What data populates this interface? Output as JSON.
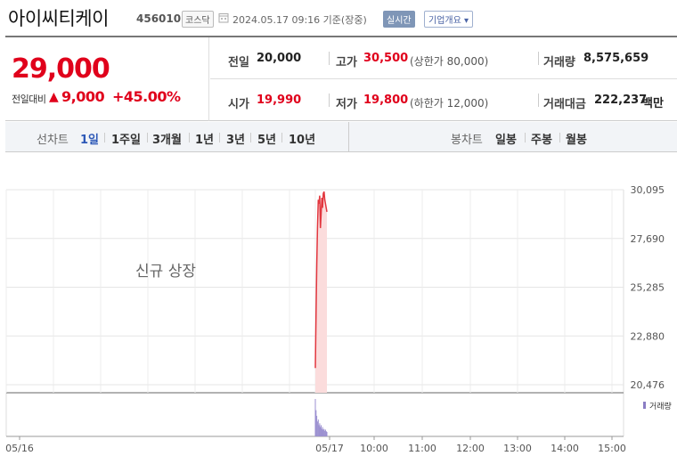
{
  "header": {
    "name": "아이씨티케이",
    "code": "456010",
    "market": "코스닥",
    "datetime": "2024.05.17 09:16 기준(장중)",
    "realtime_label": "실시간",
    "company_button": "기업개요 ▾"
  },
  "price": {
    "current": "29,000",
    "change_label": "전일대비",
    "change_arrow": "▲",
    "change": "9,000",
    "change_pct": "+45.00%"
  },
  "stats": {
    "prev_label": "전일",
    "prev": "20,000",
    "high_label": "고가",
    "high": "30,500",
    "upper_limit": "(상한가 80,000)",
    "volume_label": "거래량",
    "volume": "8,575,659",
    "open_label": "시가",
    "open": "19,990",
    "low_label": "저가",
    "low": "19,800",
    "lower_limit": "(하한가 12,000)",
    "amount_label": "거래대금",
    "amount": "222,237",
    "amount_unit": "백만"
  },
  "tabs": {
    "line_label": "선차트",
    "line_items": [
      "1일",
      "1주일",
      "3개월",
      "1년",
      "3년",
      "5년",
      "10년"
    ],
    "active": "1일",
    "candle_label": "봉차트",
    "candle_items": [
      "일봉",
      "주봉",
      "월봉"
    ]
  },
  "colors": {
    "up": "#e0001b",
    "line": "#e2373f",
    "area": "#fbdcdc",
    "volume": "#9b8fd0",
    "active_tab": "#2d58b7"
  },
  "chart_data": {
    "type": "line",
    "annotation": "신규 상장",
    "y_ticks": [
      "30,095",
      "27,690",
      "25,285",
      "22,880",
      "20,476"
    ],
    "ylim": [
      20476,
      30095
    ],
    "x_ticks": [
      "05/16",
      "05/17",
      "10:00",
      "11:00",
      "12:00",
      "13:00",
      "14:00",
      "15:00"
    ],
    "series": [
      {
        "x": [
          "09:00",
          "09:01",
          "09:02",
          "09:03",
          "09:04",
          "09:05",
          "09:06",
          "09:07",
          "09:08",
          "09:09",
          "09:10",
          "09:11",
          "09:12",
          "09:13",
          "09:14",
          "09:15",
          "09:16"
        ],
        "values": [
          21300,
          24000,
          26400,
          28200,
          29600,
          29400,
          29800,
          28200,
          28900,
          29700,
          29200,
          29900,
          30000,
          29600,
          29400,
          29200,
          29000
        ]
      }
    ],
    "volume_label": "거래량",
    "volume": [
      100,
      70,
      55,
      40,
      45,
      30,
      35,
      25,
      30,
      20,
      25,
      18,
      20,
      15,
      18,
      14,
      12
    ]
  }
}
